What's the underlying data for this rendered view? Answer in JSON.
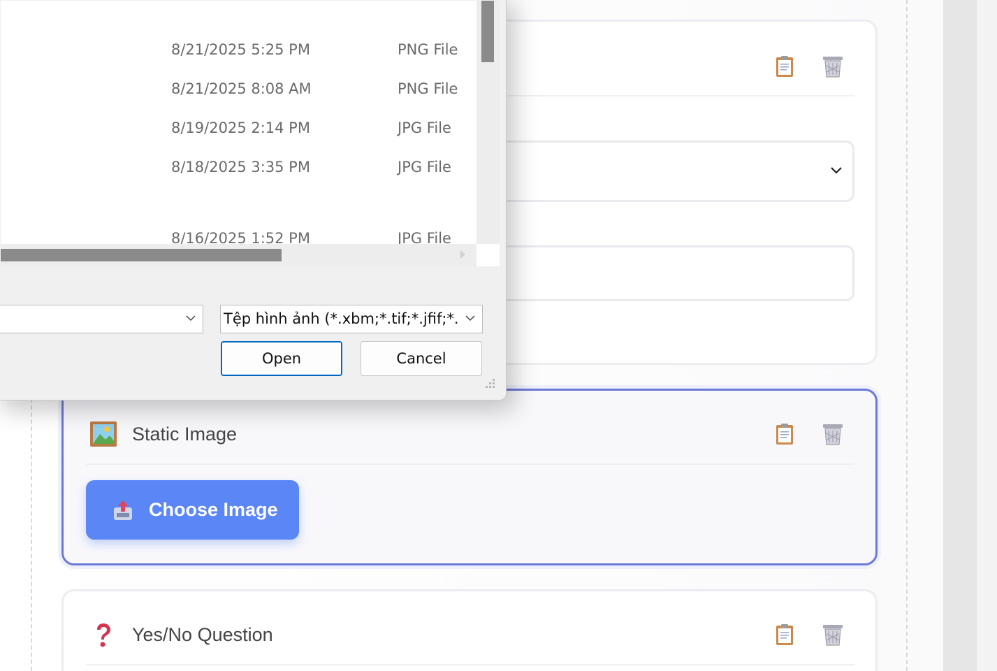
{
  "dialog": {
    "files": [
      {
        "date": "8/21/2025 5:25 PM",
        "type": "PNG File"
      },
      {
        "date": "8/21/2025 8:08 AM",
        "type": "PNG File"
      },
      {
        "date": "8/19/2025 2:14 PM",
        "type": "JPG File"
      },
      {
        "date": "8/18/2025 3:35 PM",
        "type": "JPG File"
      },
      {
        "date": "8/16/2025 1:52 PM",
        "type": "JPG File"
      }
    ],
    "filename_value": "",
    "filetype_value": "Tệp hình ảnh (*.xbm;*.tif;*.jfif;*.p",
    "open_label": "Open",
    "cancel_label": "Cancel"
  },
  "cards": {
    "static_image": {
      "title": "Static Image",
      "choose_label": "Choose Image"
    },
    "yes_no": {
      "title": "Yes/No Question"
    }
  },
  "icons": {
    "copy": "clipboard-icon",
    "delete": "trash-icon",
    "image": "framed-picture-icon",
    "upload": "upload-tray-icon",
    "question": "red-question-mark-icon",
    "select": "chevron-down-icon"
  },
  "colors": {
    "accent": "#5b86f6",
    "active_border": "#6b78d6",
    "dialog_primary": "#0067c0"
  }
}
